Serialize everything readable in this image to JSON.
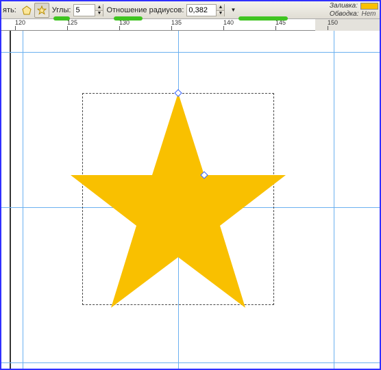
{
  "toolbar": {
    "change_label": "ять:",
    "corners_label": "Углы:",
    "corners_value": "5",
    "ratio_label": "Отношение радиусов:",
    "ratio_value": "0,382",
    "fill_label": "Заливка:",
    "stroke_label": "Обводка:",
    "stroke_value": "Нет"
  },
  "ruler": {
    "ticks": [
      "120",
      "125",
      "130",
      "135",
      "140",
      "145",
      "150"
    ]
  },
  "colors": {
    "star_fill": "#f9c000",
    "guide": "#6ab0f0",
    "accent_green": "#3fc421"
  }
}
